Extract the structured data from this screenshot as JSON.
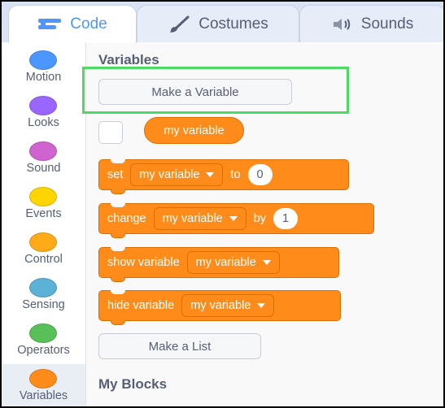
{
  "tabs": {
    "code": {
      "label": "Code",
      "icon": "code-icon",
      "color": "#4c97ff"
    },
    "costumes": {
      "label": "Costumes",
      "icon": "brush-icon"
    },
    "sounds": {
      "label": "Sounds",
      "icon": "speaker-icon"
    }
  },
  "categories": [
    {
      "label": "Motion",
      "color": "#4c97ff"
    },
    {
      "label": "Looks",
      "color": "#9966ff"
    },
    {
      "label": "Sound",
      "color": "#cf63cf"
    },
    {
      "label": "Events",
      "color": "#ffd500"
    },
    {
      "label": "Control",
      "color": "#ffab19"
    },
    {
      "label": "Sensing",
      "color": "#5cb1d6"
    },
    {
      "label": "Operators",
      "color": "#59c059"
    },
    {
      "label": "Variables",
      "color": "#ff8c1a",
      "selected": true
    }
  ],
  "palette": {
    "variables_heading": "Variables",
    "make_variable_label": "Make a Variable",
    "variable_reporter": "my variable",
    "blocks": {
      "set": {
        "keyword": "set",
        "variable": "my variable",
        "joiner": "to",
        "value": "0"
      },
      "change": {
        "keyword": "change",
        "variable": "my variable",
        "joiner": "by",
        "value": "1"
      },
      "show": {
        "keyword": "show variable",
        "variable": "my variable"
      },
      "hide": {
        "keyword": "hide variable",
        "variable": "my variable"
      }
    },
    "make_list_label": "Make a List",
    "my_blocks_heading": "My Blocks"
  },
  "colors": {
    "variables_block": "#ff8c1a",
    "highlight": "#4cd964"
  }
}
